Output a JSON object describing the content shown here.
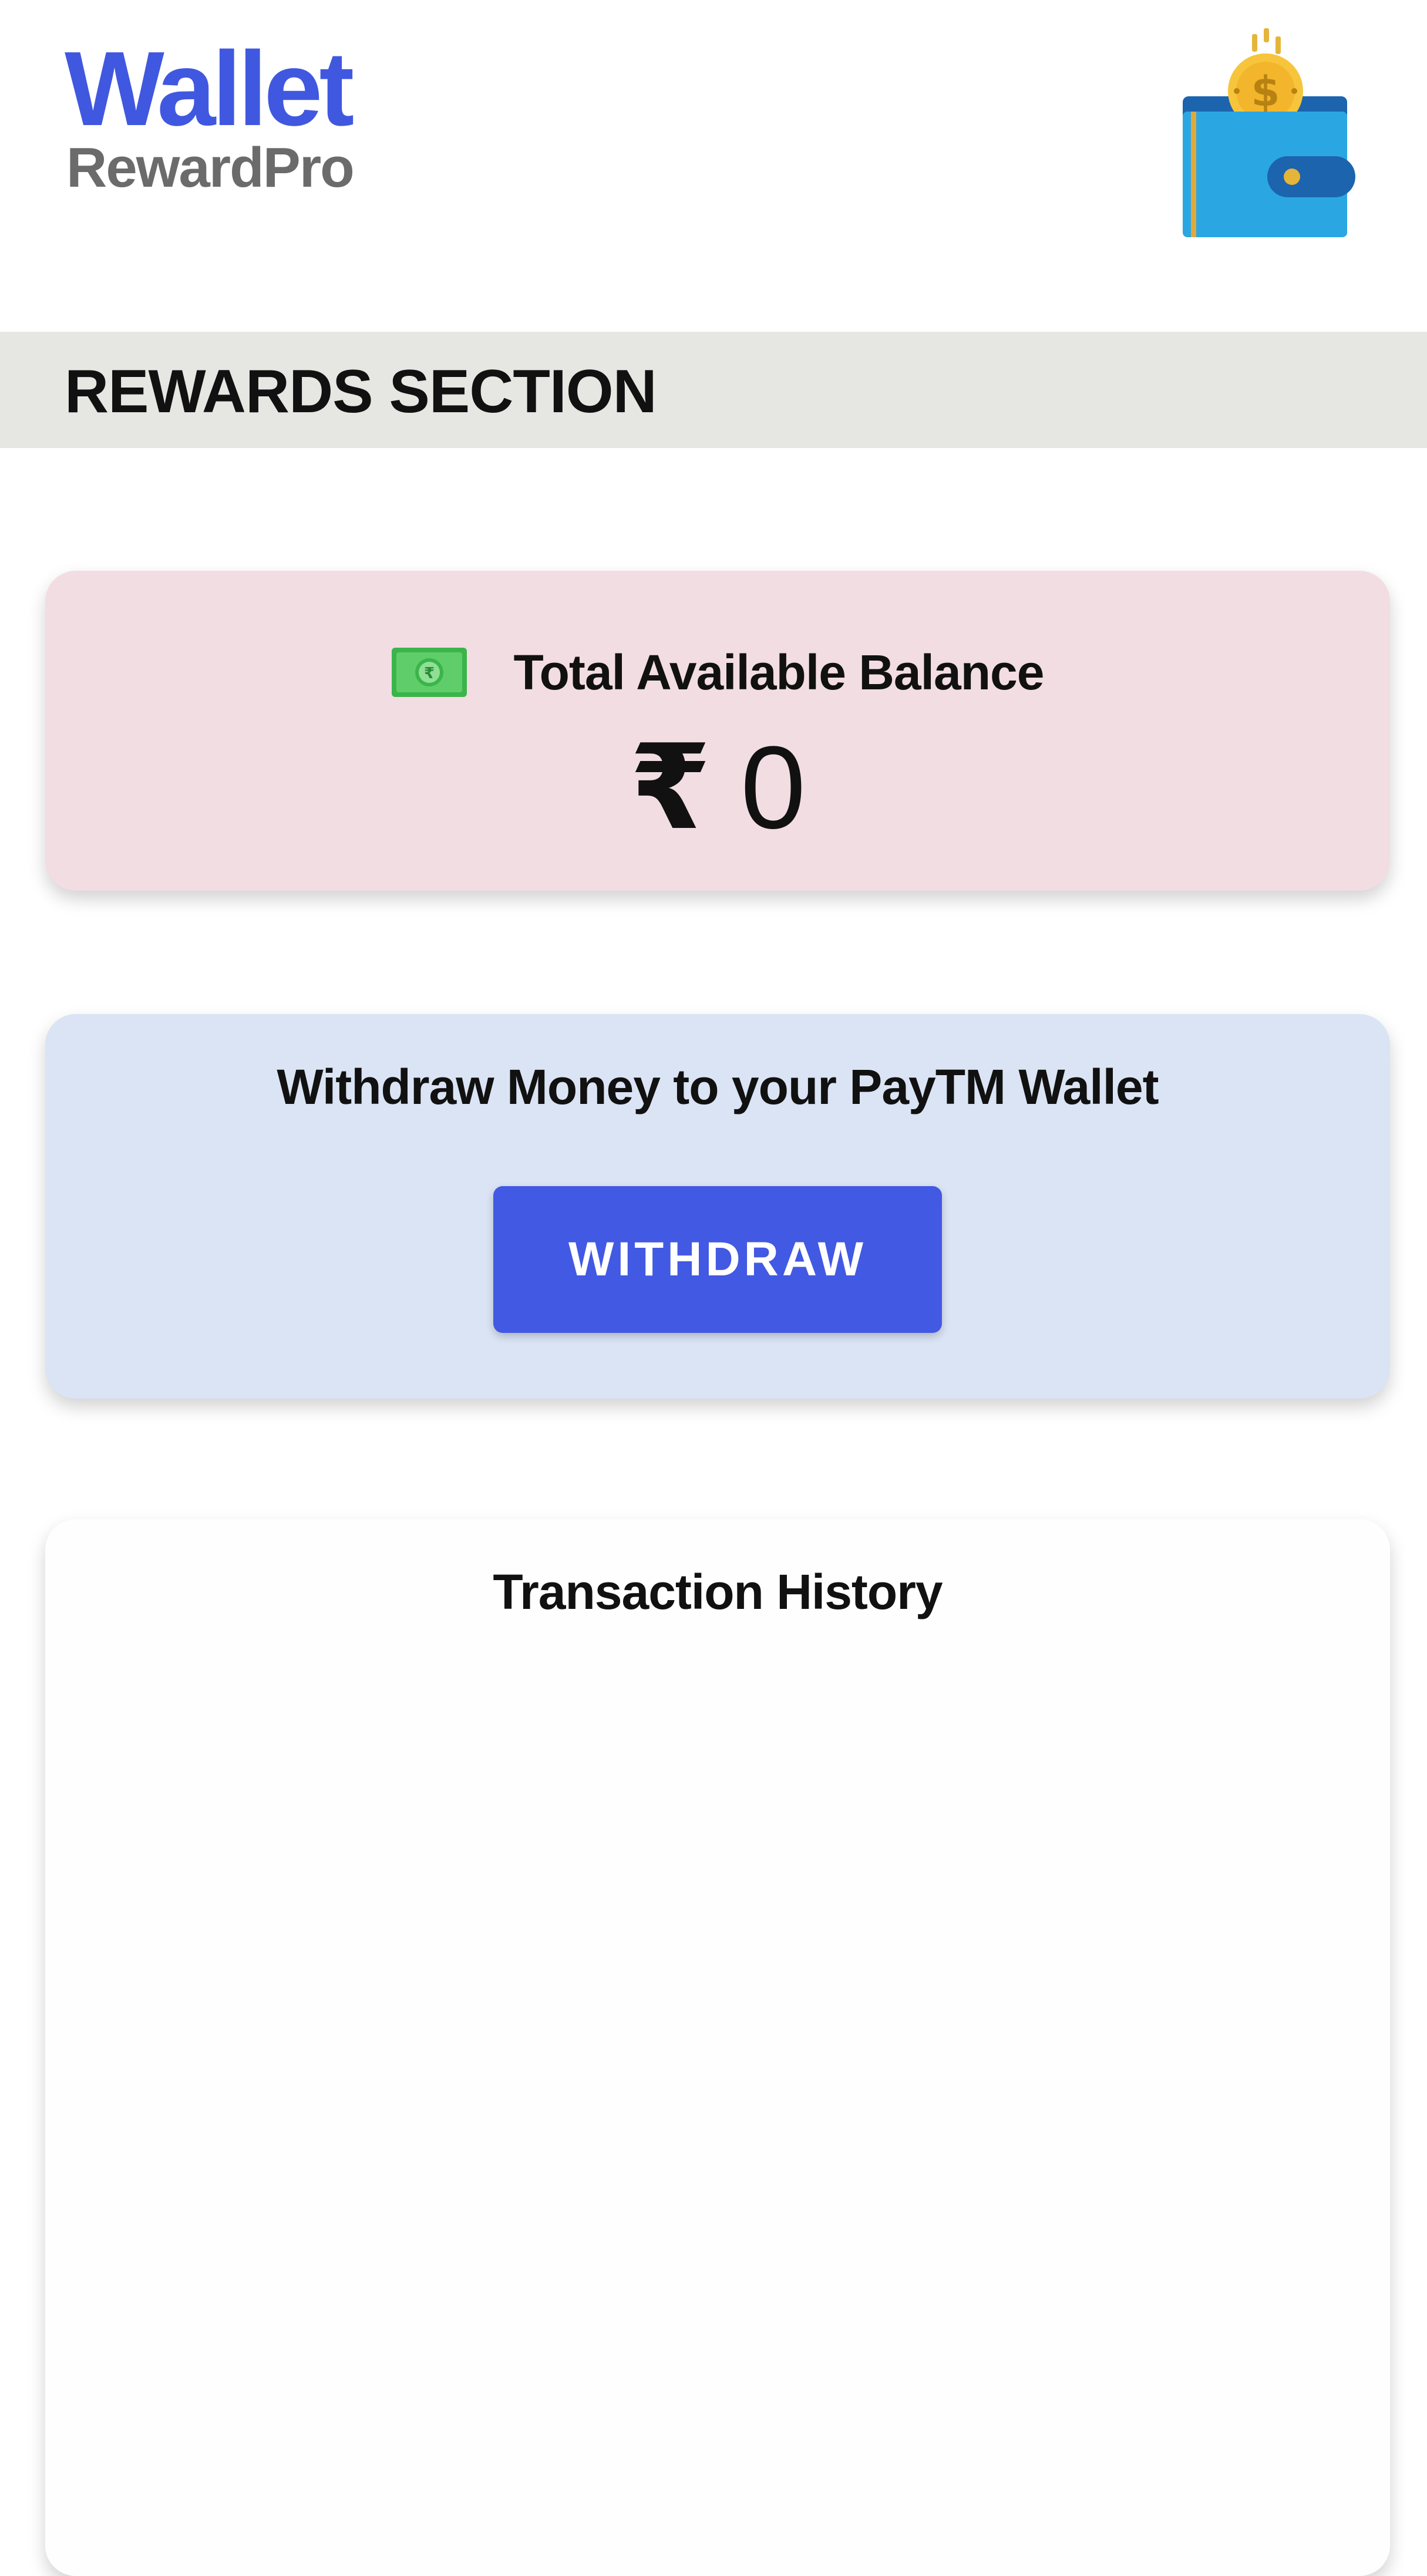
{
  "header": {
    "brand_title": "Wallet",
    "brand_subtitle": "RewardPro",
    "brand_color": "#4058e0",
    "icon": "wallet-coin-icon"
  },
  "section": {
    "title": "REWARDS SECTION"
  },
  "balance_card": {
    "icon": "money-bill-icon",
    "label": "Total Available Balance",
    "currency_symbol": "₹",
    "amount": "0",
    "background": "#f2dde3"
  },
  "withdraw_card": {
    "label": "Withdraw Money to your PayTM Wallet",
    "button_label": "WITHDRAW",
    "button_color": "#4259e3",
    "background": "#dae4f4"
  },
  "history_card": {
    "title": "Transaction History",
    "items": []
  }
}
